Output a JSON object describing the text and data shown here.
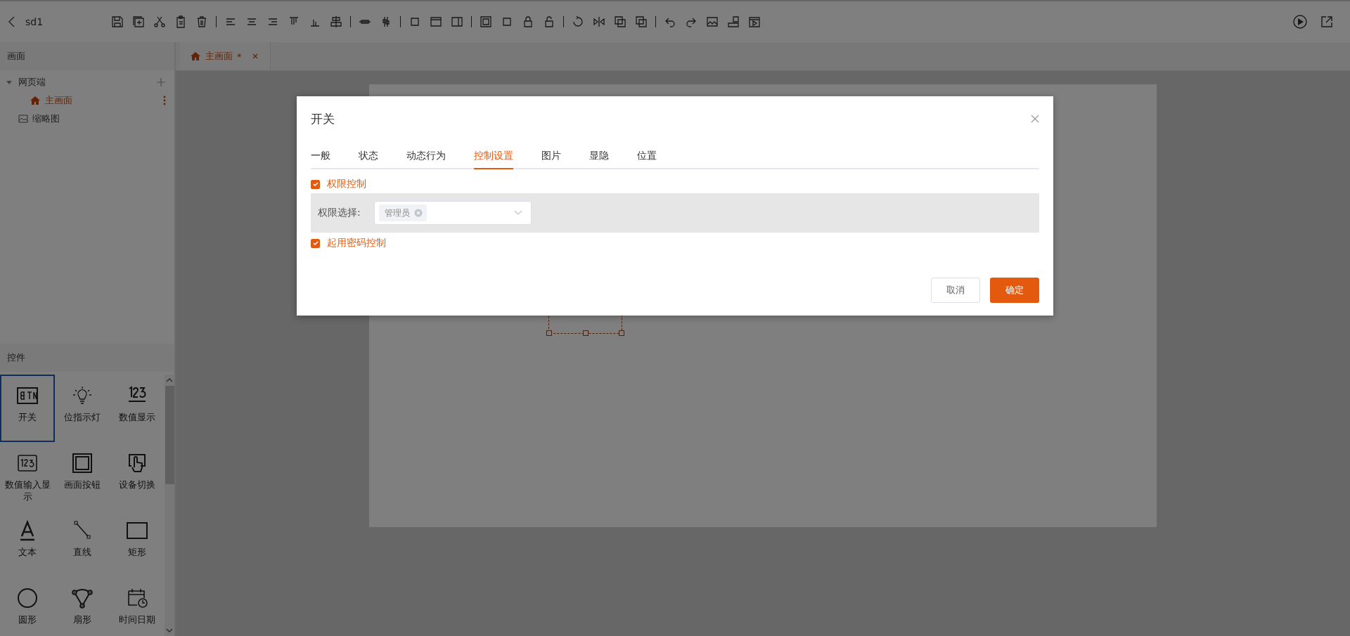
{
  "app": {
    "title": "sd1"
  },
  "sidebar": {
    "pages_header": "画面",
    "tree": [
      {
        "kind": "folder",
        "label": "网页端",
        "expanded": true,
        "selected": false,
        "children": [
          {
            "kind": "page",
            "label": "主画面",
            "selected": true
          }
        ]
      },
      {
        "kind": "thumbnail",
        "label": "缩略图",
        "selected": false
      }
    ],
    "widgets_header": "控件",
    "widgets": [
      {
        "label": "开关",
        "selected": true
      },
      {
        "label": "位指示灯",
        "selected": false
      },
      {
        "label": "数值显示",
        "selected": false
      },
      {
        "label": "数值输入显示",
        "selected": false
      },
      {
        "label": "画面按钮",
        "selected": false
      },
      {
        "label": "设备切换",
        "selected": false
      },
      {
        "label": "文本",
        "selected": false
      },
      {
        "label": "直线",
        "selected": false
      },
      {
        "label": "矩形",
        "selected": false
      },
      {
        "label": "圆形",
        "selected": false
      },
      {
        "label": "扇形",
        "selected": false
      },
      {
        "label": "时间日期",
        "selected": false
      }
    ]
  },
  "editor_tabs": [
    {
      "label": "主画面",
      "marker": "*",
      "selected": true
    }
  ],
  "dialog": {
    "title": "开关",
    "tabs": [
      {
        "label": "一般",
        "selected": false
      },
      {
        "label": "状态",
        "selected": false
      },
      {
        "label": "动态行为",
        "selected": false
      },
      {
        "label": "控制设置",
        "selected": true
      },
      {
        "label": "图片",
        "selected": false
      },
      {
        "label": "显隐",
        "selected": false
      },
      {
        "label": "位置",
        "selected": false
      }
    ],
    "permission": {
      "label": "权限控制",
      "checked": true
    },
    "role_select": {
      "label": "权限选择:",
      "tags": [
        "管理员"
      ]
    },
    "password": {
      "label": "起用密码控制",
      "checked": true
    },
    "buttons": [
      {
        "label": "取消",
        "kind": "secondary"
      },
      {
        "label": "确定",
        "kind": "primary"
      }
    ]
  }
}
